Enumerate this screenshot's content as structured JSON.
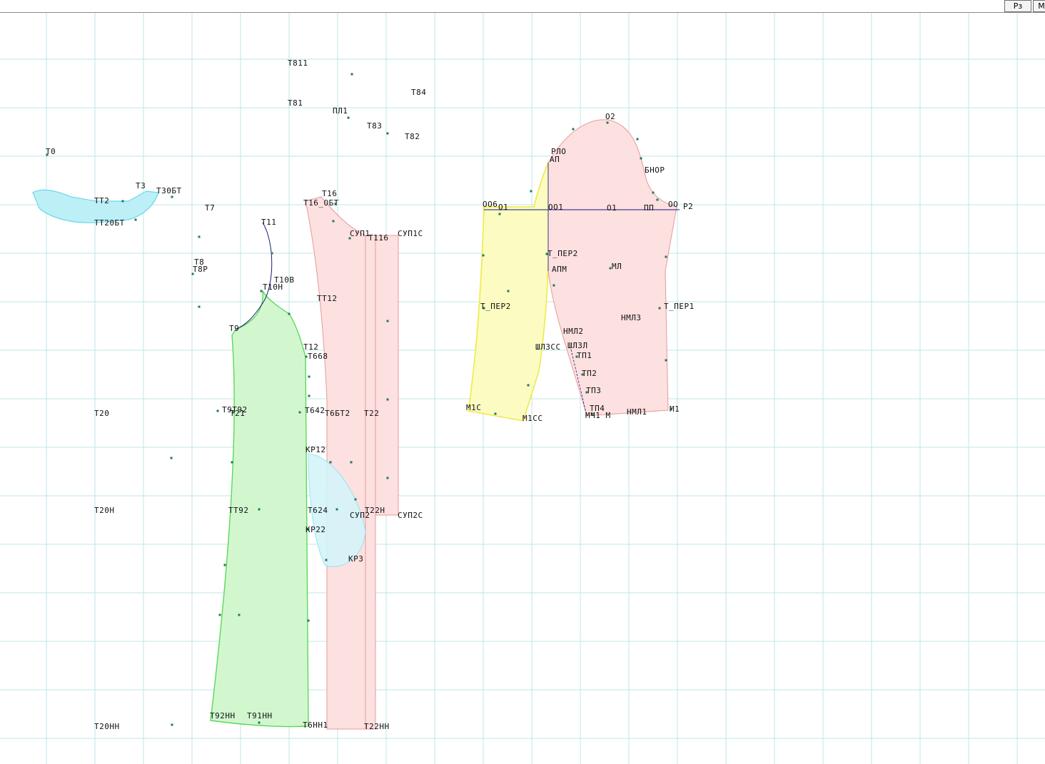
{
  "toolbar": {
    "rz_label": "Рз",
    "m_label": "М"
  },
  "colors": {
    "grid": "#bfe6ea",
    "blue_piece_fill": "#bdeff7",
    "blue_piece_stroke": "#6ad8ec",
    "pink_piece_fill": "#fde0e0",
    "pink_piece_stroke": "#e79a9a",
    "green_piece_fill": "#d2f7cf",
    "green_piece_stroke": "#5bd85b",
    "yellow_piece_fill": "#fbfbc2",
    "yellow_piece_stroke": "#f0ea45",
    "sleeve_fill": "#fde0e0",
    "sleeve_stroke": "#e79a9a",
    "construction_line": "#1a1a7a",
    "point_marker": "#1f7a5a"
  },
  "labels": {
    "t0": "Т0",
    "t2": "ТТ2",
    "t3": "Т3",
    "t30bt": "Т30БТ",
    "t20bt": "ТТ20БТ",
    "t7": "Т7",
    "t8": "Т8",
    "t8p": "Т8Р",
    "t11": "Т11",
    "t10b": "Т10В",
    "t10h": "Т10Н",
    "t9": "Т9",
    "t811": "Т811",
    "t81": "Т81",
    "pl1": "ПЛ1",
    "t84": "Т84",
    "t83": "Т83",
    "t82": "Т82",
    "t16": "Т16",
    "t16_obt": "Т16_ОБТ",
    "sup1": "СУП1",
    "t116": "Т116",
    "sup1c": "СУП1С",
    "t112": "ТТ12",
    "t12": "Т12",
    "t668": "Т668",
    "t20": "Т20",
    "t9192": "Т9Т92",
    "t21": "Т21",
    "t642": "Т642",
    "t6bt2": "Т6БТ2",
    "t22": "Т22",
    "kr12": "КР12",
    "t20h": "Т20Н",
    "tt92": "ТТ92",
    "t624": "Т624",
    "t22h": "Т22Н",
    "sup2": "СУП2",
    "sup2c": "СУП2С",
    "kr22": "КР22",
    "kr3": "КР3",
    "t92hh": "Т92НН",
    "t91hh": "Т91НН",
    "t20hh": "Т20НН",
    "t6hh": "Т6НН1",
    "t22hh": "Т22НН",
    "o2": "О2",
    "rlo": "РЛО",
    "ap": "АП",
    "bhop": "БНОР",
    "bhop2": "БНО",
    "oo6": "ОО6",
    "o1a": "О1",
    "oo1": "ОО1",
    "o1b": "О1",
    "pp": "ПП",
    "oo": "ОО",
    "p2": "Р2",
    "t_per1": "Т_ПЕР1",
    "t_per2": "Т_ПЕР2",
    "apm": "АПМ",
    "ml": "МЛ",
    "t_per2b": "Т_ПЕР2",
    "nml3": "НМЛ3",
    "nml2": "НМЛ2",
    "shl3cc": "ШЛ3СС",
    "shl3l": "ШЛ3Л",
    "tp1": "ТП1",
    "tp2": "ТП2",
    "tp3": "ТП3",
    "tp4": "ТП4",
    "m1c": "М1С",
    "m1cc": "М1СС",
    "m41": "МЧ1 М",
    "nm1": "НМЛ1",
    "m1": "М1"
  }
}
